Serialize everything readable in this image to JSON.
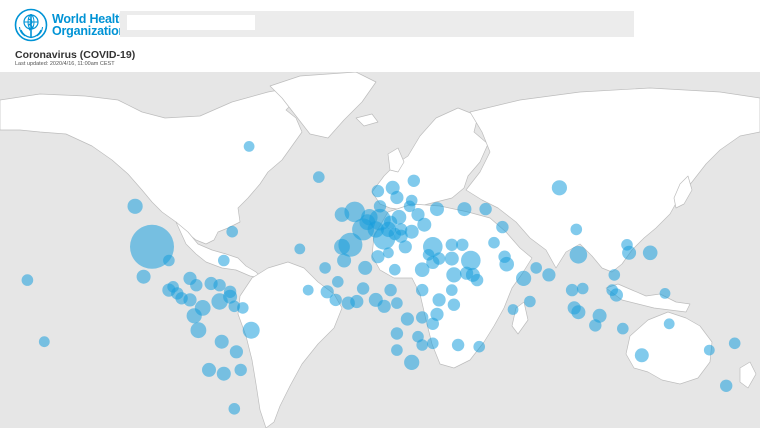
{
  "org": {
    "line1": "World Health",
    "line2": "Organization"
  },
  "search": {
    "placeholder": ""
  },
  "page": {
    "title": "Coronavirus (COVID-19)",
    "last_updated": "Last updated: 2020/4/16, 11:00am CEST"
  },
  "map": {
    "projection": "world",
    "ocean_color": "#e6e6e6",
    "land_color": "#ffffff",
    "border_color": "#bdbdbd",
    "bubble_color": "#1a9fdd",
    "bubble_opacity": 0.55,
    "bubbles": [
      {
        "lon": -98,
        "lat": 39,
        "size": 1.0
      },
      {
        "lon": -106,
        "lat": 56,
        "size": 0.12
      },
      {
        "lon": -102,
        "lat": 23,
        "size": 0.1
      },
      {
        "lon": -52,
        "lat": 72,
        "size": 0.06
      },
      {
        "lon": -19,
        "lat": 65,
        "size": 0.07
      },
      {
        "lon": -8,
        "lat": 53,
        "size": 0.11
      },
      {
        "lon": -2,
        "lat": 54,
        "size": 0.22
      },
      {
        "lon": 2,
        "lat": 47,
        "size": 0.25
      },
      {
        "lon": -4,
        "lat": 40,
        "size": 0.3
      },
      {
        "lon": -8,
        "lat": 39,
        "size": 0.13
      },
      {
        "lon": 10,
        "lat": 51,
        "size": 0.24
      },
      {
        "lon": 12,
        "lat": 43,
        "size": 0.26
      },
      {
        "lon": 35,
        "lat": 39,
        "size": 0.2
      },
      {
        "lon": 53,
        "lat": 32,
        "size": 0.2
      },
      {
        "lon": 95,
        "lat": 62,
        "size": 0.12
      },
      {
        "lon": 104,
        "lat": 35,
        "size": 0.16
      },
      {
        "lon": 45,
        "lat": 24,
        "size": 0.12
      },
      {
        "lon": 5,
        "lat": 52,
        "size": 0.14
      },
      {
        "lon": 4,
        "lat": 50,
        "size": 0.13
      },
      {
        "lon": 8,
        "lat": 47,
        "size": 0.14
      },
      {
        "lon": 14,
        "lat": 47,
        "size": 0.12
      },
      {
        "lon": 19,
        "lat": 52,
        "size": 0.11
      },
      {
        "lon": 16,
        "lat": 62,
        "size": 0.1
      },
      {
        "lon": 9,
        "lat": 61,
        "size": 0.08
      },
      {
        "lon": 26,
        "lat": 64,
        "size": 0.08
      },
      {
        "lon": 31,
        "lat": 49,
        "size": 0.1
      },
      {
        "lon": 28,
        "lat": 53,
        "size": 0.09
      },
      {
        "lon": 25,
        "lat": 46,
        "size": 0.1
      },
      {
        "lon": 22,
        "lat": 39,
        "size": 0.09
      },
      {
        "lon": 15,
        "lat": 50,
        "size": 0.09
      },
      {
        "lon": 24,
        "lat": 56,
        "size": 0.07
      },
      {
        "lon": 37,
        "lat": 55,
        "size": 0.1
      },
      {
        "lon": 50,
        "lat": 55,
        "size": 0.1
      },
      {
        "lon": 60,
        "lat": 55,
        "size": 0.08
      },
      {
        "lon": 68,
        "lat": 48,
        "size": 0.08
      },
      {
        "lon": 64,
        "lat": 41,
        "size": 0.07
      },
      {
        "lon": 69,
        "lat": 34,
        "size": 0.08
      },
      {
        "lon": 70,
        "lat": 30,
        "size": 0.11
      },
      {
        "lon": 78,
        "lat": 22,
        "size": 0.12
      },
      {
        "lon": 90,
        "lat": 24,
        "size": 0.09
      },
      {
        "lon": 84,
        "lat": 28,
        "size": 0.07
      },
      {
        "lon": 81,
        "lat": 8,
        "size": 0.07
      },
      {
        "lon": 101,
        "lat": 15,
        "size": 0.08
      },
      {
        "lon": 106,
        "lat": 16,
        "size": 0.07
      },
      {
        "lon": 102,
        "lat": 4,
        "size": 0.09
      },
      {
        "lon": 104,
        "lat": 1.3,
        "size": 0.1
      },
      {
        "lon": 114,
        "lat": -1,
        "size": 0.1
      },
      {
        "lon": 122,
        "lat": 12,
        "size": 0.09
      },
      {
        "lon": 121,
        "lat": 24,
        "size": 0.07
      },
      {
        "lon": 128,
        "lat": 36,
        "size": 0.1
      },
      {
        "lon": 138,
        "lat": 36,
        "size": 0.11
      },
      {
        "lon": 127,
        "lat": 40,
        "size": 0.07
      },
      {
        "lon": 103,
        "lat": 47,
        "size": 0.07
      },
      {
        "lon": 134,
        "lat": -25,
        "size": 0.1
      },
      {
        "lon": 174,
        "lat": -41,
        "size": 0.08
      },
      {
        "lon": 178,
        "lat": -18,
        "size": 0.07
      },
      {
        "lon": 166,
        "lat": -22,
        "size": 0.06
      },
      {
        "lon": 147,
        "lat": -6,
        "size": 0.06
      },
      {
        "lon": 145,
        "lat": 13,
        "size": 0.06
      },
      {
        "lon": -70,
        "lat": 19,
        "size": 0.09
      },
      {
        "lon": -66,
        "lat": 18,
        "size": 0.08
      },
      {
        "lon": -77,
        "lat": 18,
        "size": 0.08
      },
      {
        "lon": -80,
        "lat": 22,
        "size": 0.09
      },
      {
        "lon": -61,
        "lat": 14,
        "size": 0.08
      },
      {
        "lon": -61,
        "lat": 11,
        "size": 0.1
      },
      {
        "lon": -66,
        "lat": 8,
        "size": 0.14
      },
      {
        "lon": -74,
        "lat": 4,
        "size": 0.13
      },
      {
        "lon": -78,
        "lat": -1,
        "size": 0.12
      },
      {
        "lon": -76,
        "lat": -10,
        "size": 0.13
      },
      {
        "lon": -65,
        "lat": -17,
        "size": 0.1
      },
      {
        "lon": -58,
        "lat": -23,
        "size": 0.09
      },
      {
        "lon": -51,
        "lat": -10,
        "size": 0.15
      },
      {
        "lon": -64,
        "lat": -35,
        "size": 0.1
      },
      {
        "lon": -71,
        "lat": -33,
        "size": 0.1
      },
      {
        "lon": -56,
        "lat": -33,
        "size": 0.08
      },
      {
        "lon": -59,
        "lat": -51,
        "size": 0.07
      },
      {
        "lon": -55,
        "lat": 4,
        "size": 0.07
      },
      {
        "lon": -59,
        "lat": 5,
        "size": 0.07
      },
      {
        "lon": -90,
        "lat": 15,
        "size": 0.09
      },
      {
        "lon": -86,
        "lat": 13,
        "size": 0.08
      },
      {
        "lon": -84,
        "lat": 10,
        "size": 0.08
      },
      {
        "lon": -80,
        "lat": 9,
        "size": 0.09
      },
      {
        "lon": -88,
        "lat": 17,
        "size": 0.07
      },
      {
        "lon": -90,
        "lat": 32,
        "size": 0.07
      },
      {
        "lon": -64,
        "lat": 32,
        "size": 0.07
      },
      {
        "lon": -60,
        "lat": 46,
        "size": 0.07
      },
      {
        "lon": 3,
        "lat": 28,
        "size": 0.1
      },
      {
        "lon": -7,
        "lat": 32,
        "size": 0.1
      },
      {
        "lon": 9,
        "lat": 34,
        "size": 0.09
      },
      {
        "lon": 30,
        "lat": 27,
        "size": 0.11
      },
      {
        "lon": 17,
        "lat": 27,
        "size": 0.07
      },
      {
        "lon": 30,
        "lat": 15,
        "size": 0.08
      },
      {
        "lon": -15,
        "lat": 14,
        "size": 0.09
      },
      {
        "lon": -11,
        "lat": 9,
        "size": 0.08
      },
      {
        "lon": -5,
        "lat": 7,
        "size": 0.09
      },
      {
        "lon": -1,
        "lat": 8,
        "size": 0.09
      },
      {
        "lon": 8,
        "lat": 9,
        "size": 0.1
      },
      {
        "lon": 12,
        "lat": 5,
        "size": 0.09
      },
      {
        "lon": 18,
        "lat": 7,
        "size": 0.07
      },
      {
        "lon": 23,
        "lat": -3,
        "size": 0.09
      },
      {
        "lon": 38,
        "lat": 9,
        "size": 0.09
      },
      {
        "lon": 45,
        "lat": 6,
        "size": 0.08
      },
      {
        "lon": 37,
        "lat": 0,
        "size": 0.09
      },
      {
        "lon": 35,
        "lat": -6,
        "size": 0.08
      },
      {
        "lon": 30,
        "lat": -2,
        "size": 0.08
      },
      {
        "lon": 18,
        "lat": -12,
        "size": 0.08
      },
      {
        "lon": 28,
        "lat": -14,
        "size": 0.07
      },
      {
        "lon": 35,
        "lat": -18,
        "size": 0.07
      },
      {
        "lon": 30,
        "lat": -19,
        "size": 0.07
      },
      {
        "lon": 25,
        "lat": -29,
        "size": 0.12
      },
      {
        "lon": 18,
        "lat": -22,
        "size": 0.07
      },
      {
        "lon": 47,
        "lat": -19,
        "size": 0.08
      },
      {
        "lon": 57,
        "lat": -20,
        "size": 0.07
      },
      {
        "lon": 15,
        "lat": 15,
        "size": 0.08
      },
      {
        "lon": 2,
        "lat": 16,
        "size": 0.08
      },
      {
        "lon": -10,
        "lat": 20,
        "size": 0.07
      },
      {
        "lon": 44,
        "lat": 15,
        "size": 0.07
      },
      {
        "lon": 56,
        "lat": 21,
        "size": 0.08
      },
      {
        "lon": 51,
        "lat": 25,
        "size": 0.09
      },
      {
        "lon": 54,
        "lat": 24,
        "size": 0.1
      },
      {
        "lon": 44,
        "lat": 33,
        "size": 0.1
      },
      {
        "lon": 38,
        "lat": 33,
        "size": 0.08
      },
      {
        "lon": 35,
        "lat": 31,
        "size": 0.09
      },
      {
        "lon": 44,
        "lat": 40,
        "size": 0.08
      },
      {
        "lon": 49,
        "lat": 40,
        "size": 0.08
      },
      {
        "lon": 18,
        "lat": 59,
        "size": 0.09
      },
      {
        "lon": 10,
        "lat": 56,
        "size": 0.08
      },
      {
        "lon": 25,
        "lat": 58,
        "size": 0.07
      },
      {
        "lon": 20,
        "lat": 44,
        "size": 0.09
      },
      {
        "lon": 17,
        "lat": 45,
        "size": 0.08
      },
      {
        "lon": 20,
        "lat": 47,
        "size": 0.08
      },
      {
        "lon": 33,
        "lat": 35,
        "size": 0.07
      },
      {
        "lon": 14,
        "lat": 36,
        "size": 0.06
      },
      {
        "lon": -28,
        "lat": 38,
        "size": 0.06
      },
      {
        "lon": -16,
        "lat": 28,
        "size": 0.07
      },
      {
        "lon": -24,
        "lat": 15,
        "size": 0.06
      },
      {
        "lon": 73,
        "lat": 3,
        "size": 0.06
      },
      {
        "lon": 125,
        "lat": -9,
        "size": 0.07
      },
      {
        "lon": 112,
        "lat": -7,
        "size": 0.08
      },
      {
        "lon": 120,
        "lat": 15,
        "size": 0.07
      },
      {
        "lon": -157,
        "lat": 21,
        "size": 0.07
      },
      {
        "lon": -149,
        "lat": -17,
        "size": 0.06
      }
    ]
  }
}
